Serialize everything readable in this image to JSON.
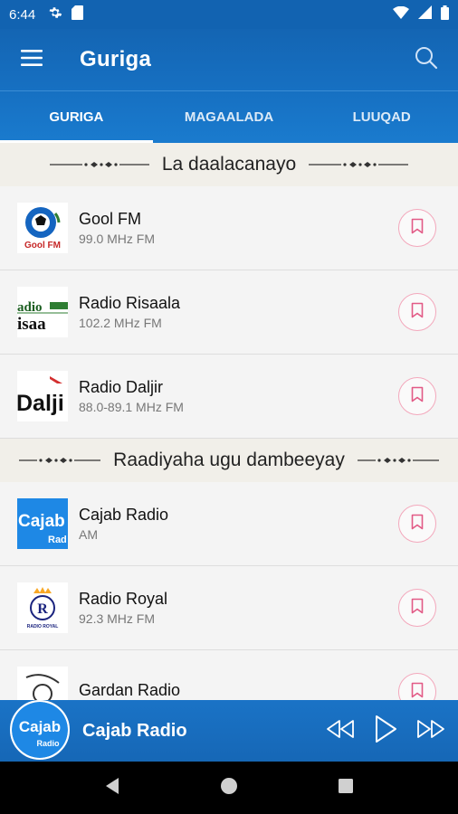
{
  "status_bar": {
    "time": "6:44"
  },
  "app_bar": {
    "title": "Guriga"
  },
  "tabs": [
    {
      "label": "GURIGA",
      "active": true
    },
    {
      "label": "MAGAALADA",
      "active": false
    },
    {
      "label": "LUUQAD",
      "active": false
    }
  ],
  "sections": [
    {
      "title": "La daalacanayo",
      "stations": [
        {
          "name": "Gool FM",
          "freq": "99.0 MHz FM",
          "logo_text": "Gool FM"
        },
        {
          "name": "Radio Risaala",
          "freq": "102.2 MHz FM",
          "logo_text": "Radio Risaala"
        },
        {
          "name": "Radio Daljir",
          "freq": "88.0-89.1 MHz FM",
          "logo_text": "Dalji"
        }
      ]
    },
    {
      "title": "Raadiyaha ugu dambeeyay",
      "stations": [
        {
          "name": "Cajab Radio",
          "freq": "AM",
          "logo_text": "Cajab Radio"
        },
        {
          "name": "Radio Royal",
          "freq": "92.3 MHz FM",
          "logo_text": "RADIO ROYAL"
        },
        {
          "name": "Gardan Radio",
          "freq": "",
          "logo_text": ""
        }
      ]
    }
  ],
  "player": {
    "station": "Cajab Radio",
    "logo_text": "Cajab Radio"
  },
  "colors": {
    "primary": "#1670c2",
    "accent_pink": "#e25a86",
    "background": "#f4f4f4"
  }
}
